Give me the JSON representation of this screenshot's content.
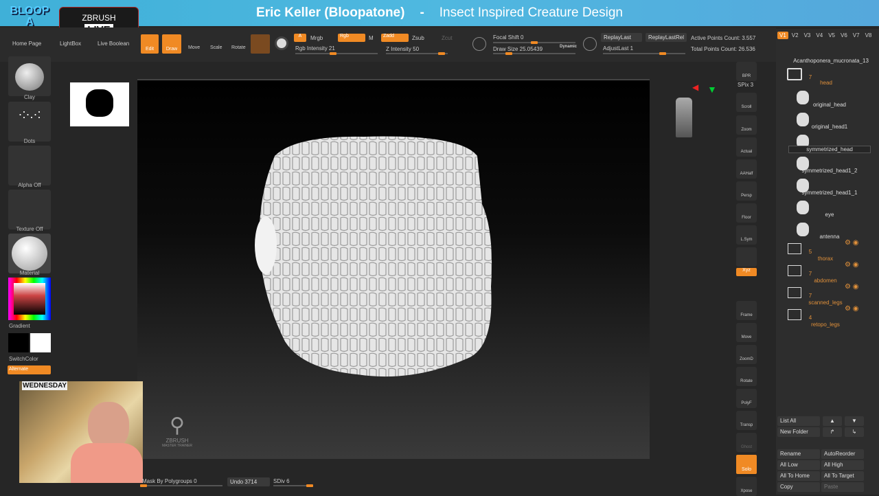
{
  "header": {
    "presenter": "Eric Keller (Bloopatone)",
    "separator": "-",
    "course": "Insect Inspired Creature Design",
    "logo": "BLOOP A TONE",
    "live_logo_top": "ZBRUSH",
    "live_logo": "LIVE"
  },
  "toolbar": {
    "home_page": "Home Page",
    "lightbox": "LightBox",
    "live_boolean": "Live Boolean",
    "edit": "Edit",
    "draw": "Draw",
    "move": "Move",
    "scale": "Scale",
    "rotate": "Rotate",
    "a": "A",
    "mrgb": "Mrgb",
    "rgb": "Rgb",
    "m": "M",
    "zadd": "Zadd",
    "zsub": "Zsub",
    "zcut": "Zcut",
    "rgb_intensity": "Rgb Intensity 21",
    "z_intensity": "Z Intensity 50",
    "rgb_intensity_value": 21,
    "z_intensity_value": 50,
    "focal_shift": "Focal Shift 0",
    "draw_size": "Draw Size 25.05439",
    "dynamic": "Dynamic",
    "replay_last": "ReplayLast",
    "replay_last_rel": "ReplayLastRel",
    "adjust_last": "AdjustLast 1",
    "active_points": "Active Points Count: 3.557",
    "total_points": "Total Points Count: 26.536"
  },
  "left_tray": {
    "brush": "Clay",
    "stroke": "Dots",
    "alpha": "Alpha Off",
    "texture": "Texture Off",
    "material": "Material",
    "gradient": "Gradient",
    "switch_color": "SwitchColor",
    "alternate": "Alternate"
  },
  "shelf": [
    "BPR",
    "SPix 3",
    "Scroll",
    "Zoom",
    "Actual",
    "AAHalf",
    "Persp",
    "Floor",
    "L.Sym",
    "",
    "Xyz",
    "",
    "Frame",
    "Move",
    "ZoomD",
    "Rotate",
    "PolyF",
    "Transp",
    "Ghost",
    "Solo",
    "Xpose"
  ],
  "subtool": {
    "versions": [
      "V1",
      "V2",
      "V3",
      "V4",
      "V5",
      "V6",
      "V7",
      "V8"
    ],
    "top_name": "Acanthoponera_mucronata_13",
    "head_folder": {
      "count": "7",
      "name": "head"
    },
    "items": [
      "original_head",
      "original_head1",
      "symmetrized_head",
      "symmetrized_head1_2",
      "symmetrized_head1_1",
      "eye",
      "antenna"
    ],
    "folders": [
      {
        "count": "5",
        "name": "thorax"
      },
      {
        "count": "7",
        "name": "abdomen"
      },
      {
        "count": "7",
        "name": "scanned_legs"
      },
      {
        "count": "4",
        "name": "retopo_legs"
      }
    ],
    "buttons": {
      "list_all": "List All",
      "new_folder": "New Folder",
      "rename": "Rename",
      "auto_reorder": "AutoReorder",
      "all_low": "All Low",
      "all_high": "All High",
      "all_to_home": "All To Home",
      "all_to_target": "All To Target",
      "copy": "Copy",
      "paste": "Paste"
    }
  },
  "bottom": {
    "mask_by_polygroups": "Mask By Polygroups 0",
    "undo": "Undo 3714",
    "sdiv": "SDiv 6"
  },
  "watermark": {
    "brand": "ZBRUSH",
    "sub": "MASTER TRAINER"
  },
  "webcam": {
    "sign": "WEDNESDAY"
  },
  "colors": {
    "accent": "#f08a24",
    "header": "#4fb8e0"
  }
}
